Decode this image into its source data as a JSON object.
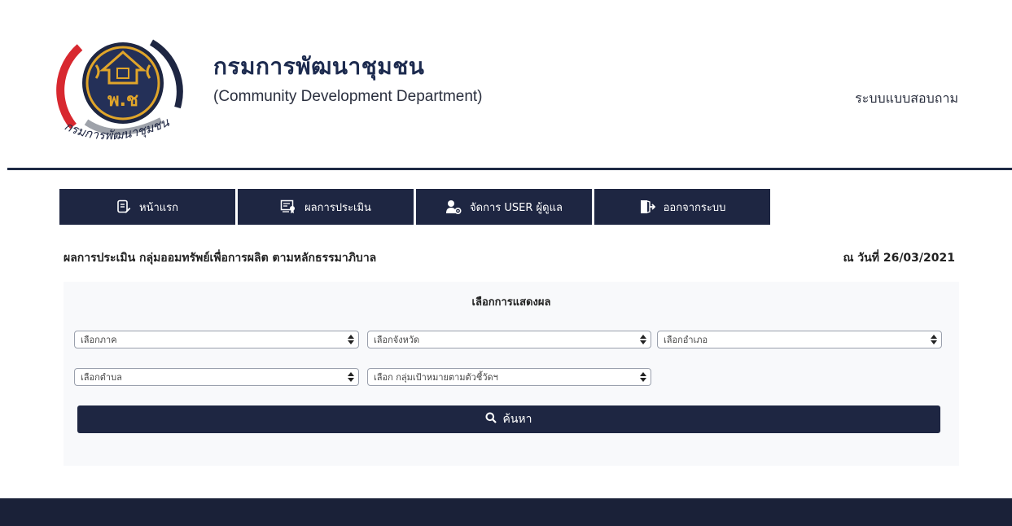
{
  "header": {
    "org_title": "กรมการพัฒนาชุมชน",
    "org_subtitle": "(Community Development Department)",
    "system_name": "ระบบแบบสอบถาม",
    "logo_text": "กรมการพัฒนาชุมชน",
    "logo_mark": "พ.ช"
  },
  "nav": {
    "items": [
      {
        "label": "หน้าแรก",
        "icon": "document-edit-icon"
      },
      {
        "label": "ผลการประเมิน",
        "icon": "certificate-icon"
      },
      {
        "label": "จัดการ USER ผู้ดูแล",
        "icon": "user-settings-icon"
      },
      {
        "label": "ออกจากระบบ",
        "icon": "logout-icon"
      }
    ]
  },
  "page": {
    "heading": "ผลการประเมิน กลุ่มออมทรัพย์เพื่อการผลิต ตามหลักธรรมาภิบาล",
    "date_label": "ณ วันที่ 26/03/2021"
  },
  "filters": {
    "title": "เลือกการแสดงผล",
    "region": "เลือกภาค",
    "province": "เลือกจังหวัด",
    "district": "เลือกอำเภอ",
    "subdistrict": "เลือกตำบล",
    "target_group": "เลือก กลุ่มเป้าหมายตามตัวชี้วัดฯ",
    "search_label": "ค้นหา"
  },
  "colors": {
    "navy": "#1e2642",
    "accent_red": "#d8282f",
    "logo_gold": "#e0a52a"
  }
}
